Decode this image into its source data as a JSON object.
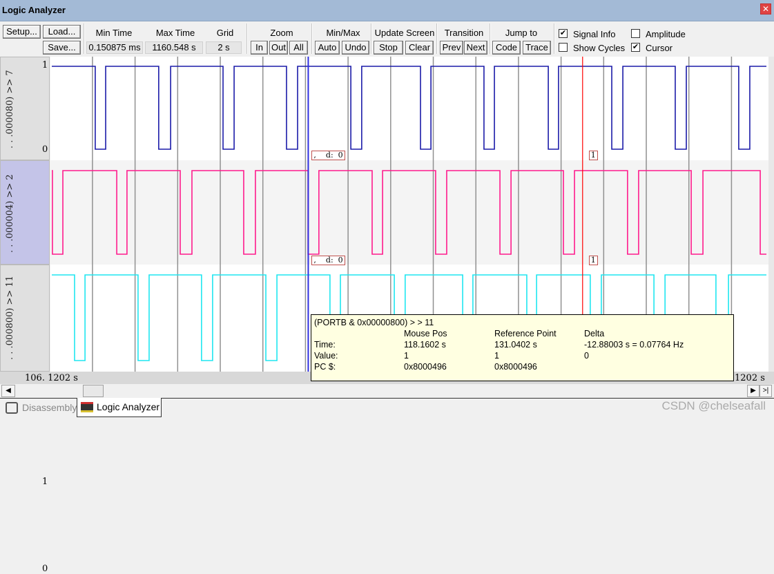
{
  "window": {
    "title": "Logic Analyzer",
    "close_icon": "close-icon"
  },
  "toolbar": {
    "setup": "Setup...",
    "load": "Load...",
    "save": "Save...",
    "min_time_label": "Min Time",
    "min_time": "0.150875 ms",
    "max_time_label": "Max Time",
    "max_time": "1160.548 s",
    "grid_label": "Grid",
    "grid": "2 s",
    "zoom_label": "Zoom",
    "zoom_in": "In",
    "zoom_out": "Out",
    "zoom_all": "All",
    "minmax_label": "Min/Max",
    "auto": "Auto",
    "undo": "Undo",
    "update_label": "Update Screen",
    "stop": "Stop",
    "clear": "Clear",
    "transition_label": "Transition",
    "prev": "Prev",
    "next": "Next",
    "jump_label": "Jump to",
    "code": "Code",
    "trace": "Trace",
    "signal_info": {
      "label": "Signal Info",
      "checked": true
    },
    "amplitude": {
      "label": "Amplitude",
      "checked": false
    },
    "show_cycles": {
      "label": "Show Cycles",
      "checked": false
    },
    "cursor": {
      "label": "Cursor",
      "checked": true
    }
  },
  "view": {
    "start_time": 106.1202,
    "end_time": 139.67,
    "grid_s": 2,
    "left_time_label": "106. 1202  s",
    "right_time_label": "1202  s"
  },
  "signals": [
    {
      "name": ". . .000080) >> 7",
      "high": "1",
      "low": "0",
      "color": "#1a1aa8",
      "selected": false,
      "low_intervals": [
        [
          108.16,
          108.65
        ],
        [
          111.14,
          111.7
        ],
        [
          114.16,
          114.68
        ],
        [
          117.14,
          117.66
        ],
        [
          120.16,
          120.67
        ],
        [
          123.43,
          123.92
        ],
        [
          126.41,
          126.9
        ],
        [
          129.43,
          129.91
        ],
        [
          132.41,
          132.93
        ],
        [
          135.39,
          135.91
        ],
        [
          138.37,
          138.89
        ]
      ],
      "cursor_marker": ",    d:  0",
      "ref_marker": "1"
    },
    {
      "name": ". . .000004) >> 2",
      "high": "1",
      "low": "0",
      "color": "#ff1a8c",
      "selected": true,
      "low_intervals": [
        [
          106.15,
          106.64
        ],
        [
          109.17,
          109.65
        ],
        [
          112.15,
          112.7
        ],
        [
          115.13,
          115.68
        ],
        [
          118.15,
          118.66
        ],
        [
          121.16,
          121.65
        ],
        [
          124.14,
          124.66
        ],
        [
          127.16,
          127.68
        ],
        [
          130.14,
          130.66
        ],
        [
          133.15,
          133.67
        ],
        [
          136.14,
          136.69
        ],
        [
          139.38,
          139.67
        ]
      ],
      "cursor_marker": ",    d:  0",
      "ref_marker": "1"
    },
    {
      "name": ". . .000800) >> 11",
      "high": "1",
      "low": "0",
      "color": "#1ee6f0",
      "selected": false,
      "low_intervals": [
        [
          107.19,
          107.68
        ],
        [
          110.17,
          110.69
        ],
        [
          113.15,
          113.67
        ],
        [
          116.17,
          116.69
        ],
        [
          119.18,
          119.67
        ],
        [
          122.2,
          122.71
        ],
        [
          125.41,
          125.89
        ],
        [
          128.42,
          128.88
        ],
        [
          131.4,
          131.92
        ],
        [
          134.39,
          134.91
        ],
        [
          137.3,
          137.89
        ]
      ]
    }
  ],
  "cursors": {
    "mouse_time": 118.1602,
    "reference_time": 131.0402,
    "mouse_color": "#3030e0",
    "reference_color": "#ff0000"
  },
  "tooltip": {
    "title": "(PORTB & 0x00000800) > > 11",
    "col_mouse": "Mouse Pos",
    "col_ref": "Reference Point",
    "col_delta": "Delta",
    "time_label": "Time:",
    "time_mouse": "118.1602 s",
    "time_ref": "131.0402 s",
    "time_delta": "-12.88003 s = 0.07764 Hz",
    "value_label": "Value:",
    "value_mouse": "1",
    "value_ref": "1",
    "value_delta": "0",
    "pc_label": "PC $:",
    "pc_mouse": "0x8000496",
    "pc_ref": "0x8000496"
  },
  "tabs": [
    {
      "label": "Disassembly",
      "icon": "disassembly-icon",
      "active": false
    },
    {
      "label": "Logic Analyzer",
      "icon": "logic-analyzer-icon",
      "active": true
    }
  ],
  "watermark": "CSDN @chelseafall"
}
